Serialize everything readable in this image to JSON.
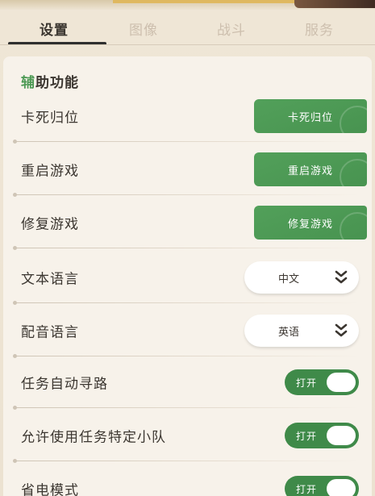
{
  "tabs": [
    {
      "label": "设置",
      "active": true
    },
    {
      "label": "图像",
      "active": false
    },
    {
      "label": "战斗",
      "active": false
    },
    {
      "label": "服务",
      "active": false
    }
  ],
  "section": {
    "title_accent": "辅",
    "title_rest": "助功能"
  },
  "settings": {
    "stuck_reset": {
      "label": "卡死归位",
      "button": "卡死归位"
    },
    "restart_game": {
      "label": "重启游戏",
      "button": "重启游戏"
    },
    "repair_game": {
      "label": "修复游戏",
      "button": "修复游戏"
    },
    "text_language": {
      "label": "文本语言",
      "value": "中文",
      "icon": "chevron-double-down-icon"
    },
    "voice_language": {
      "label": "配音语言",
      "value": "英语",
      "icon": "chevron-double-down-icon"
    },
    "quest_auto_path": {
      "label": "任务自动寻路",
      "state": "打开"
    },
    "allow_quest_team": {
      "label": "允许使用任务特定小队",
      "state": "打开"
    },
    "power_saving": {
      "label": "省电模式",
      "state": "打开"
    }
  },
  "colors": {
    "accent_green": "#4e9a55",
    "toggle_green": "#3f8a49",
    "background": "#efe6d6"
  }
}
